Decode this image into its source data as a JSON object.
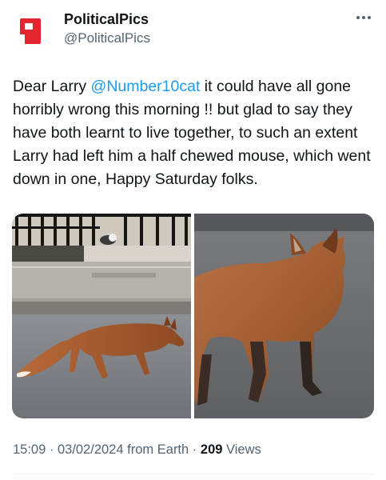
{
  "author": {
    "display_name": "PoliticalPics",
    "handle": "@PoliticalPics",
    "avatar_letter": "P",
    "avatar_color": "#e3262e"
  },
  "tweet": {
    "text_before": "Dear Larry ",
    "mention": "@Number10cat",
    "text_after": " it could have all gone horribly wrong this morning !! but glad to say they have both learnt to live together, to such an extent Larry had left him a half chewed mouse, which went down in one, Happy Saturday folks."
  },
  "media": [
    {
      "subject": "fox-walking-street-photo"
    },
    {
      "subject": "fox-closeup-photo"
    }
  ],
  "meta": {
    "time": "15:09",
    "separator": "·",
    "date": "03/02/2024",
    "source": "from Earth",
    "views_count": "209",
    "views_label": "Views"
  },
  "colors": {
    "text": "#0f1419",
    "secondary": "#536471",
    "link": "#1d9bf0"
  }
}
